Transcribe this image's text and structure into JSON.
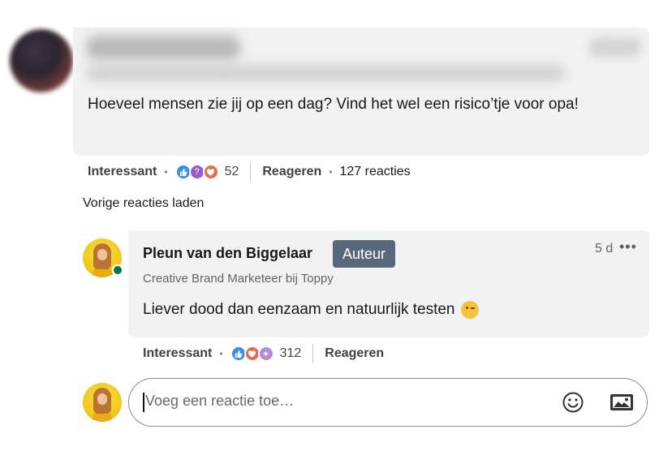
{
  "comment": {
    "text": "Hoeveel mensen zie jij op een dag? Vind het wel een risico’tje voor opa!",
    "actions": {
      "like_label": "Interessant",
      "reaction_count": "52",
      "reply_label": "Reageren",
      "replies_count": "127 reacties"
    }
  },
  "load_previous": "Vorige reacties laden",
  "reply": {
    "author": "Pleun van den Biggelaar",
    "badge": "Auteur",
    "headline": "Creative Brand Marketeer bij Toppy",
    "time": "5 d",
    "more": "•••",
    "text": "Liever dood dan eenzaam en natuurlijk testen",
    "actions": {
      "like_label": "Interessant",
      "reaction_count": "312",
      "reply_label": "Reageren"
    }
  },
  "composer": {
    "placeholder": "Voeg een reactie toe…"
  },
  "icons": {
    "like": "thumbs-up-icon",
    "curious": "curious-icon",
    "love": "heart-icon",
    "insightful": "insightful-icon",
    "emoji": "emoji-smile-icon",
    "image": "image-icon",
    "wink": "wink-emoji-icon"
  },
  "colors": {
    "like": "#378fe9",
    "love": "#df704d",
    "curious": "#9b5bd0",
    "badge": "#56687a",
    "online": "#057642",
    "bubble": "#f2f2f2"
  }
}
